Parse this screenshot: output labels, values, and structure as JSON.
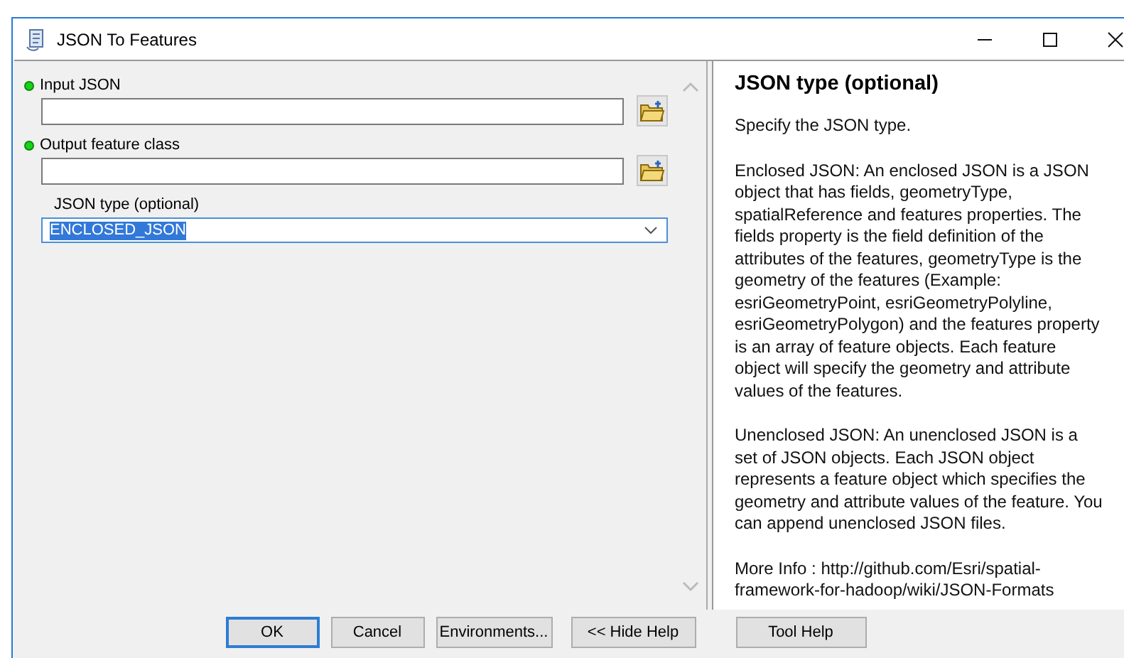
{
  "window": {
    "title": "JSON To Features"
  },
  "parameters": [
    {
      "kind": "path",
      "label": "Input JSON",
      "required": true
    },
    {
      "kind": "path",
      "label": "Output feature class",
      "required": true
    },
    {
      "kind": "dropdown",
      "label": "JSON type (optional)",
      "required": false,
      "value": "ENCLOSED_JSON",
      "selected": true
    }
  ],
  "help": {
    "title": "JSON type (optional)",
    "paragraphs": [
      "Specify the JSON type.",
      "Enclosed JSON: An enclosed JSON is a JSON object that has fields, geometryType, spatialReference and features properties. The fields property is the field definition of the attributes of the features, geometryType is the geometry of the features (Example: esriGeometryPoint, esriGeometryPolyline, esriGeometryPolygon) and the features property is an array of feature objects. Each feature object will specify the geometry and attribute values of the features.",
      "Unenclosed JSON: An unenclosed JSON is a set of JSON objects. Each JSON object represents a feature object which specifies the geometry and attribute values of the feature. You can append unenclosed JSON files.",
      "More Info : http://github.com/Esri/spatial-framework-for-hadoop/wiki/JSON-Formats"
    ]
  },
  "buttons": [
    {
      "label": "OK",
      "default": true
    },
    {
      "label": "Cancel",
      "default": false
    },
    {
      "label": "Environments...",
      "default": false
    },
    {
      "label": "<< Hide Help",
      "default": false
    },
    {
      "label": "Tool Help",
      "default": false
    }
  ]
}
